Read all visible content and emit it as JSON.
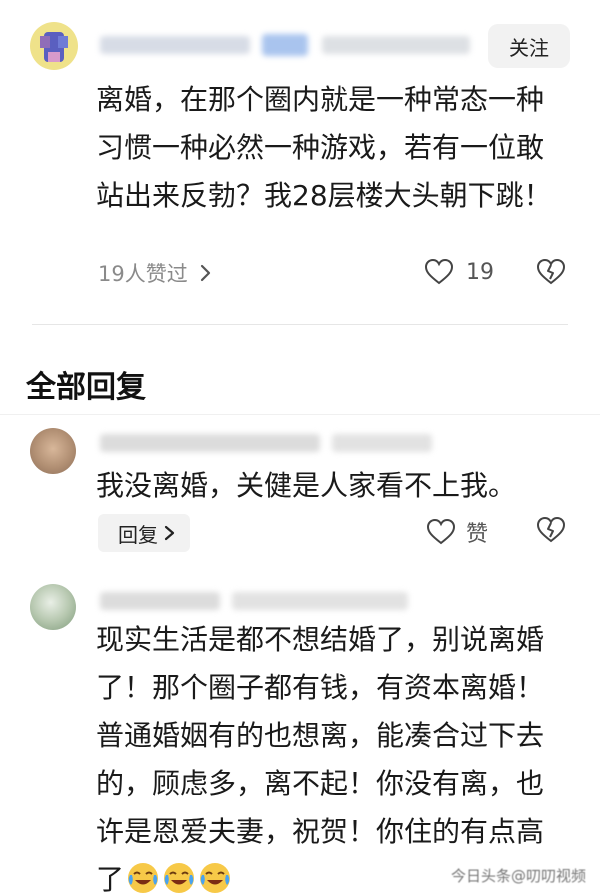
{
  "post": {
    "follow_label": "关注",
    "body": "离婚，在那个圈内就是一种常态一种习惯一种必然一种游戏，若有一位敢站出来反勃？我28层楼大头朝下跳！",
    "likers_label": "19人赞过",
    "like_count": "19"
  },
  "replies": {
    "section_title": "全部回复",
    "items": [
      {
        "body": "我没离婚，关健是人家看不上我。",
        "reply_label": "回复",
        "like_label": "赞"
      },
      {
        "body": "现实生活是都不想结婚了，别说离婚了！那个圈子都有钱，有资本离婚！普通婚姻有的也想离，能凑合过下去的，顾虑多，离不起！你没有离，也许是恩爱夫妻，祝贺！你住的有点高了"
      }
    ]
  },
  "watermark": "今日头条@叨叨视频",
  "colors": {
    "text": "#1a1a1a",
    "meta": "#8a8a8a",
    "button_bg": "#f2f2f2",
    "divider": "#e6e6e6"
  }
}
